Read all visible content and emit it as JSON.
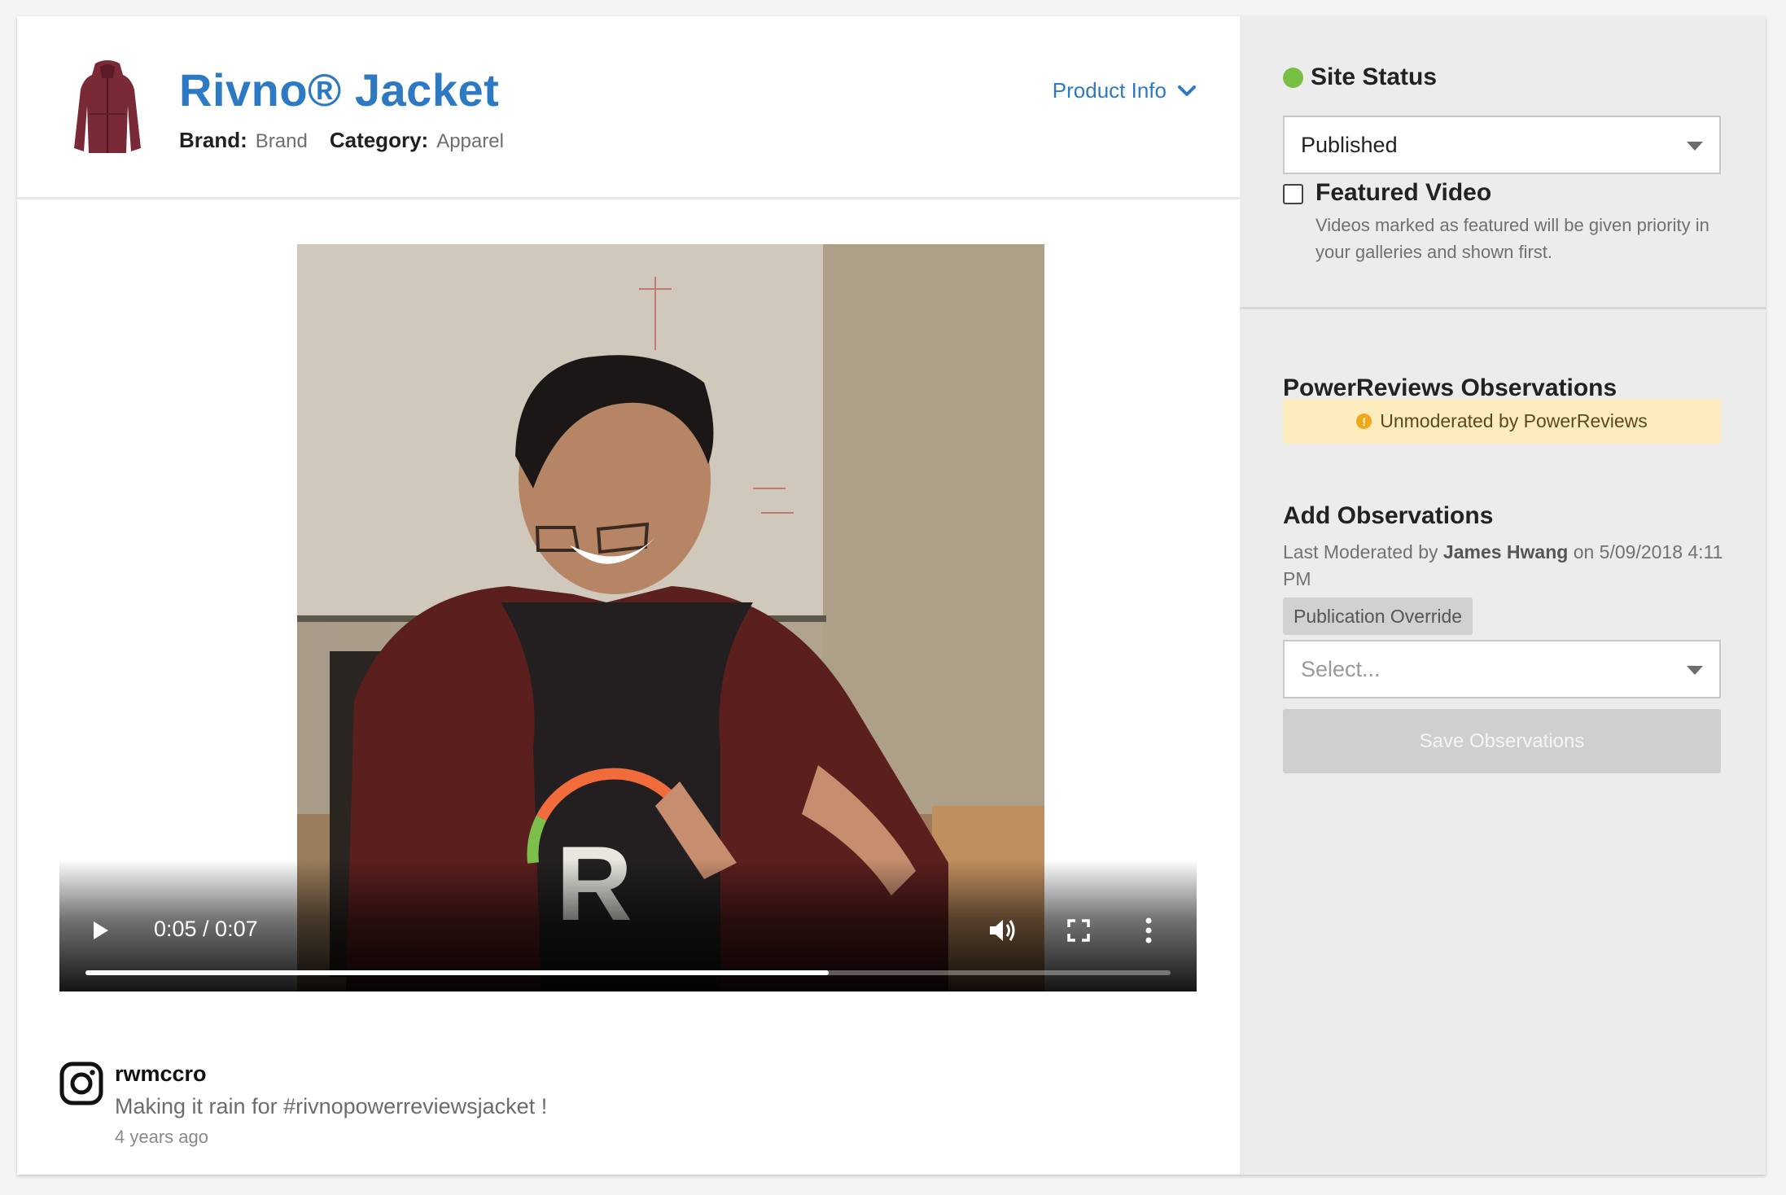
{
  "product": {
    "title": "Rivno® Jacket",
    "brand_key": "Brand:",
    "brand_value": "Brand",
    "category_key": "Category:",
    "category_value": "Apparel",
    "info_toggle": "Product Info"
  },
  "video": {
    "time": "0:05 / 0:07",
    "progress": 0.685
  },
  "post": {
    "username": "rwmccro",
    "caption": "Making it rain for #rivnopowerreviewsjacket !",
    "age": "4 years ago"
  },
  "sidebar": {
    "site_status_label": "Site Status",
    "site_status_value": "Published",
    "featured_label": "Featured Video",
    "featured_desc": "Videos marked as featured will be given priority in your galleries and shown first.",
    "observations_title": "PowerReviews Observations",
    "moderation_badge": "Unmoderated by PowerReviews",
    "add_title": "Add Observations",
    "last_mod_prefix": "Last Moderated by",
    "last_mod_user": "James Hwang",
    "last_mod_suffix": "on 5/09/2018 4:11 PM",
    "override_chip": "Publication Override",
    "override_placeholder": "Select...",
    "save_label": "Save Observations"
  },
  "colors": {
    "accent": "#2e79c4",
    "status_green": "#78c043",
    "banner_bg": "#fdecbd",
    "banner_icon": "#f0a818"
  }
}
